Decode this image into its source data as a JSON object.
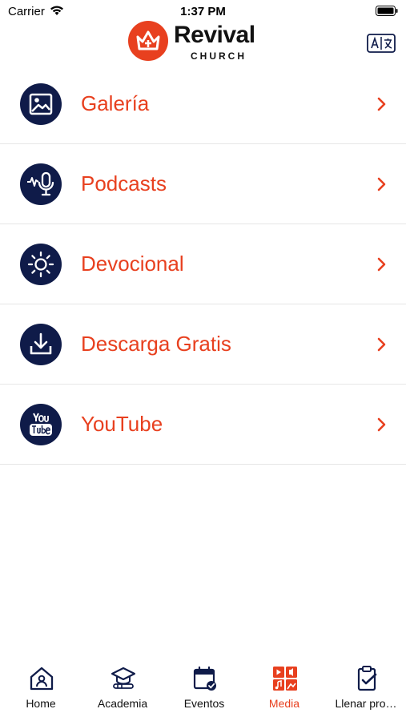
{
  "status_bar": {
    "carrier": "Carrier",
    "time": "1:37 PM"
  },
  "header": {
    "logo_word": "Revival",
    "logo_sub": "CHURCH",
    "translate_icon": "translate-icon"
  },
  "colors": {
    "accent": "#e8401f",
    "navy": "#0f1b49",
    "divider": "#e6e6e6"
  },
  "menu": {
    "items": [
      {
        "label": "Galería",
        "icon": "gallery-icon"
      },
      {
        "label": "Podcasts",
        "icon": "microphone-icon"
      },
      {
        "label": "Devocional",
        "icon": "sun-icon"
      },
      {
        "label": "Descarga Gratis",
        "icon": "download-icon"
      },
      {
        "label": "YouTube",
        "icon": "youtube-icon"
      }
    ]
  },
  "tabbar": {
    "items": [
      {
        "label": "Home",
        "icon": "home-icon",
        "active": false
      },
      {
        "label": "Academia",
        "icon": "graduation-cap-icon",
        "active": false
      },
      {
        "label": "Eventos",
        "icon": "calendar-icon",
        "active": false
      },
      {
        "label": "Media",
        "icon": "media-grid-icon",
        "active": true
      },
      {
        "label": "Llenar pro…",
        "icon": "clipboard-icon",
        "active": false
      }
    ]
  }
}
